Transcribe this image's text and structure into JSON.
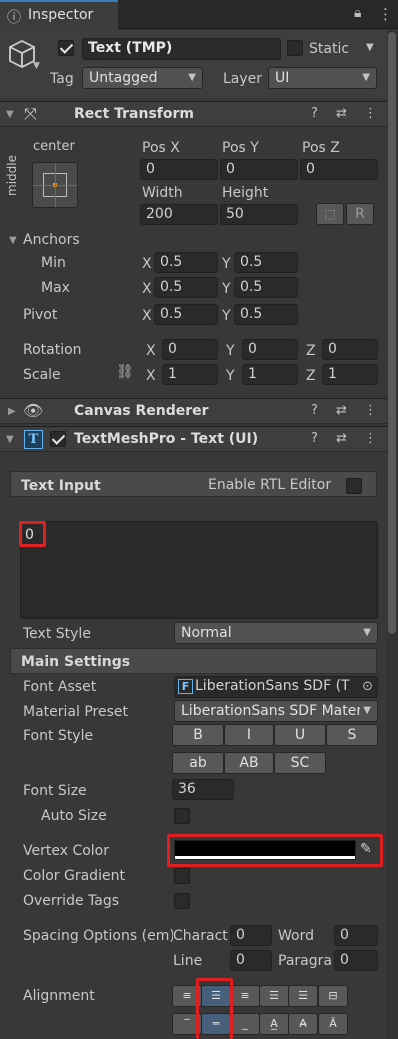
{
  "tab": {
    "title": "Inspector"
  },
  "object": {
    "name": "Text (TMP)",
    "static_label": "Static",
    "tag_label": "Tag",
    "tag_value": "Untagged",
    "layer_label": "Layer",
    "layer_value": "UI"
  },
  "rect": {
    "title": "Rect Transform",
    "anchor_h": "center",
    "anchor_v": "middle",
    "posx_label": "Pos X",
    "posy_label": "Pos Y",
    "posz_label": "Pos Z",
    "posx": "0",
    "posy": "0",
    "posz": "0",
    "width_label": "Width",
    "height_label": "Height",
    "width": "200",
    "height": "50",
    "r_btn": "R",
    "anchors_label": "Anchors",
    "min_label": "Min",
    "max_label": "Max",
    "pivot_label": "Pivot",
    "x": "X",
    "y": "Y",
    "z": "Z",
    "min_x": "0.5",
    "min_y": "0.5",
    "max_x": "0.5",
    "max_y": "0.5",
    "pivot_x": "0.5",
    "pivot_y": "0.5",
    "rotation_label": "Rotation",
    "rot_x": "0",
    "rot_y": "0",
    "rot_z": "0",
    "scale_label": "Scale",
    "scale_x": "1",
    "scale_y": "1",
    "scale_z": "1"
  },
  "canvas": {
    "title": "Canvas Renderer"
  },
  "tmp": {
    "title": "TextMeshPro - Text (UI)",
    "text_input_label": "Text Input",
    "rtl_label": "Enable RTL Editor",
    "text_value": "0",
    "text_style_label": "Text Style",
    "text_style_value": "Normal",
    "main_settings": "Main Settings",
    "font_asset_label": "Font Asset",
    "font_asset_value": "LiberationSans SDF (T",
    "material_preset_label": "Material Preset",
    "material_preset_value": "LiberationSans SDF Materi",
    "font_style_label": "Font Style",
    "fs_b": "B",
    "fs_i": "I",
    "fs_u": "U",
    "fs_s": "S",
    "fs_ab": "ab",
    "fs_AB": "AB",
    "fs_sc": "SC",
    "font_size_label": "Font Size",
    "font_size": "36",
    "auto_size_label": "Auto Size",
    "vertex_color_label": "Vertex Color",
    "vertex_color": "#000000",
    "color_gradient_label": "Color Gradient",
    "override_tags_label": "Override Tags",
    "spacing_label": "Spacing Options (em)",
    "character_label": "Charact",
    "word_label": "Word",
    "line_label": "Line",
    "paragraph_label": "Paragra",
    "char_sp": "0",
    "word_sp": "0",
    "line_sp": "0",
    "para_sp": "0",
    "alignment_label": "Alignment"
  }
}
